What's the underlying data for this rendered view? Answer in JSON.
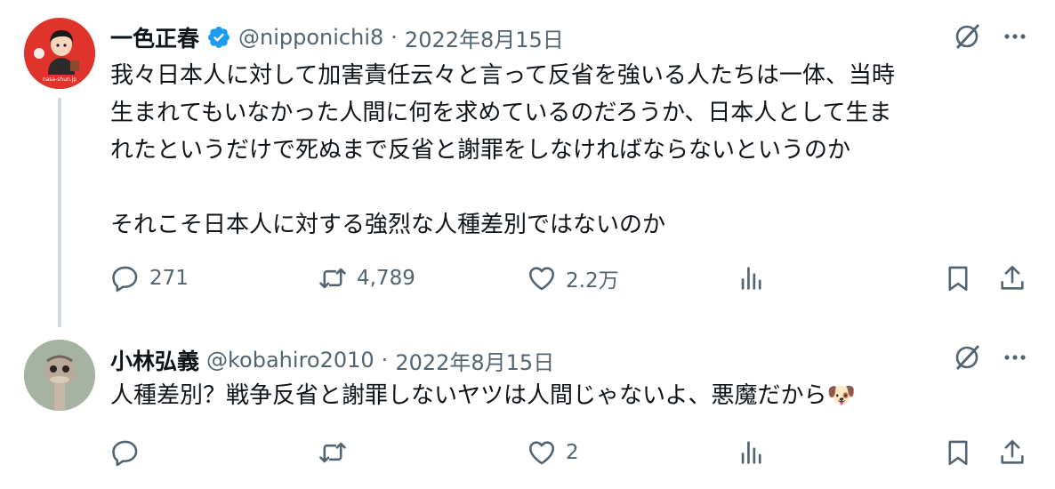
{
  "tweets": [
    {
      "author_name": "一色正春",
      "handle": "@nipponichi8",
      "separator": "·",
      "date": "2022年8月15日",
      "verified": true,
      "text_lines": [
        "我々日本人に対して加害責任云々と言って反省を強いる人たちは一体、当時",
        "生まれてもいなかった人間に何を求めているのだろうか、日本人として生ま",
        "れたというだけで死ぬまで反省と謝罪をしなければならないというのか",
        "",
        "それこそ日本人に対する強烈な人種差別ではないのか"
      ],
      "replies": "271",
      "retweets": "4,789",
      "likes": "2.2万",
      "avatar_caption": "nasa-shun.jp"
    },
    {
      "author_name": "小林弘義",
      "handle": "@kobahiro2010",
      "separator": "·",
      "date": "2022年8月15日",
      "verified": false,
      "text": "人種差別？戦争反省と謝罪しないヤツは人間じゃないよ、悪魔だから",
      "emoji": "🐶",
      "replies": "",
      "retweets": "",
      "likes": "2"
    }
  ],
  "colors": {
    "text": "#0f1419",
    "secondary": "#536471",
    "verified_blue": "#1d9bf0",
    "avatar_red": "#e0332b",
    "thread_line": "#cfd9de"
  },
  "icons": [
    "reply-icon",
    "retweet-icon",
    "like-icon",
    "views-icon",
    "bookmark-icon",
    "share-icon",
    "grok-icon",
    "more-icon",
    "verified-badge-icon"
  ]
}
